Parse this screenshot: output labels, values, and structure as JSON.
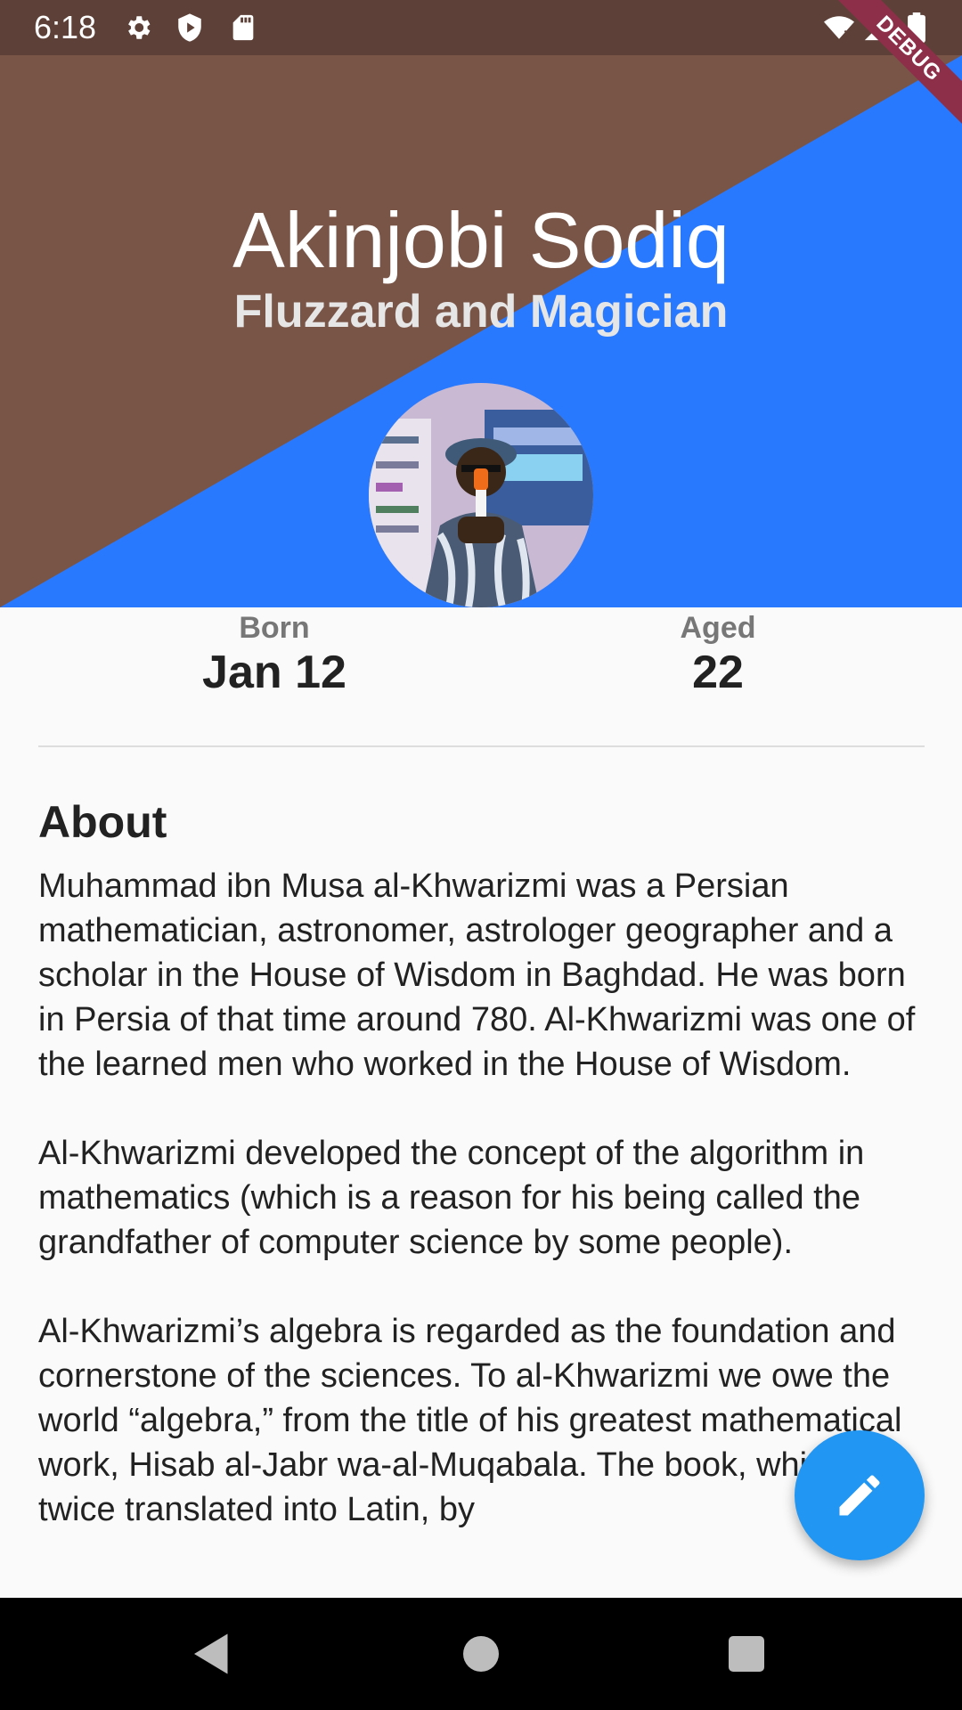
{
  "status_bar": {
    "time": "6:18",
    "left_icons": [
      "gear-icon",
      "shield-play-icon",
      "sd-card-icon"
    ],
    "right_icons": [
      "wifi-icon",
      "signal-icon",
      "battery-icon"
    ]
  },
  "debug_banner": {
    "label": "DEBUG"
  },
  "header": {
    "name": "Akinjobi Sodiq",
    "subtitle": "Fluzzard and Magician",
    "colors": {
      "brown": "#795548",
      "blue": "#2979ff",
      "status": "#5d4037"
    }
  },
  "stats": {
    "born": {
      "label": "Born",
      "value": "Jan 12"
    },
    "aged": {
      "label": "Aged",
      "value": "22"
    }
  },
  "about": {
    "heading": "About",
    "paragraphs": [
      "Muhammad ibn Musa al-Khwarizmi was a Persian mathematician, astronomer, astrologer geographer and a scholar in the House of Wisdom in Baghdad. He was born in Persia of that time around 780. Al-Khwarizmi was one of the learned men who worked in the House of Wisdom.",
      "Al-Khwarizmi developed the concept of the algorithm in mathematics (which is a reason for his being called the grandfather of computer science by some people).",
      "Al-Khwarizmi’s algebra is regarded as the foundation and cornerstone of the sciences. To al-Khwarizmi we owe the world “algebra,” from the title of his greatest mathematical work, Hisab al-Jabr wa-al-Muqabala. The book, which was twice translated into Latin, by"
    ]
  },
  "fab": {
    "icon": "edit-pencil-icon",
    "color": "#2196f3"
  },
  "nav_bar": {
    "icons": [
      "back-icon",
      "home-icon",
      "recents-icon"
    ]
  }
}
